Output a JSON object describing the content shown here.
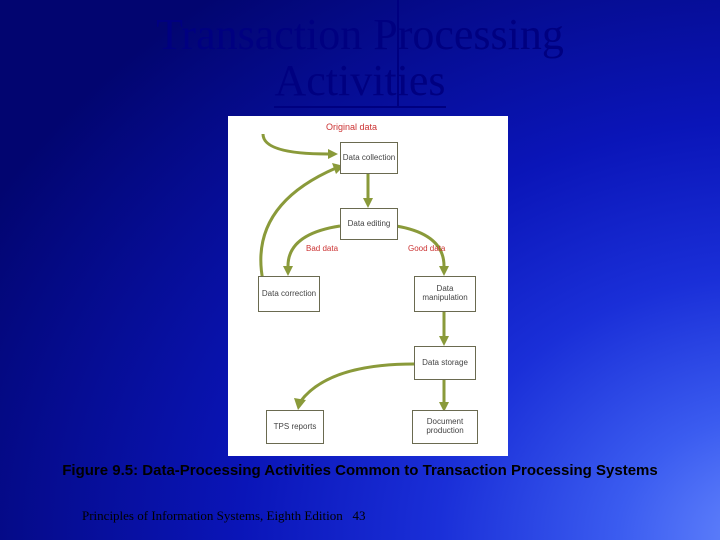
{
  "title_line1": "Transaction Processing",
  "title_line2": "Activities",
  "caption": "Figure 9.5: Data-Processing Activities Common to Transaction Processing Systems",
  "footer_text": "Principles of Information Systems, Eighth Edition",
  "page_number": "43",
  "diagram": {
    "original": "Original data",
    "boxes": {
      "collection": "Data collection",
      "editing": "Data editing",
      "correction": "Data correction",
      "manipulation": "Data manipulation",
      "storage": "Data storage",
      "tps": "TPS reports",
      "document": "Document production"
    },
    "edge_bad": "Bad data",
    "edge_good": "Good data"
  }
}
